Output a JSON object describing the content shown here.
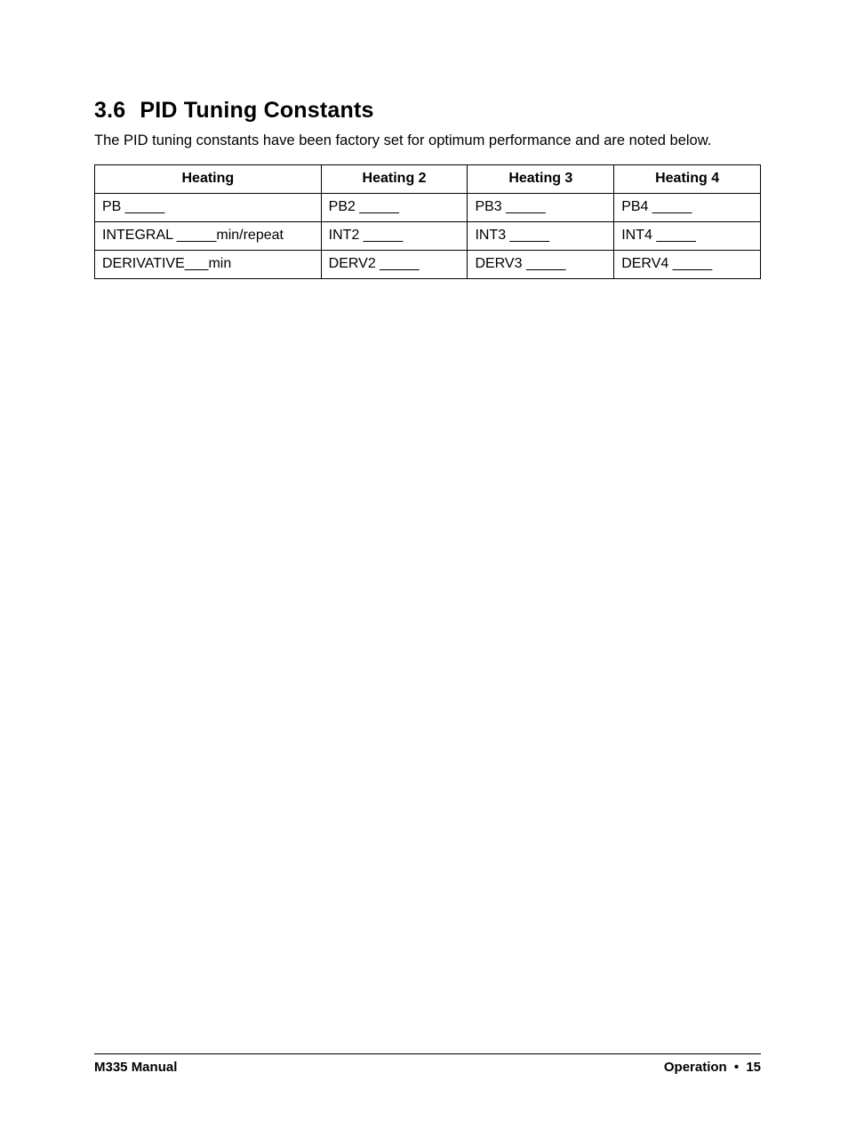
{
  "heading": {
    "number": "3.6",
    "title": "PID Tuning Constants"
  },
  "intro": "The PID tuning constants have been factory set for optimum performance and are noted below.",
  "table": {
    "headers": [
      "Heating",
      "Heating 2",
      "Heating 3",
      "Heating 4"
    ],
    "rows": [
      [
        "PB _____",
        "PB2 _____",
        "PB3 _____",
        "PB4 _____"
      ],
      [
        "INTEGRAL _____min/repeat",
        "INT2 _____",
        "INT3 _____",
        "INT4 _____"
      ],
      [
        "DERIVATIVE___min",
        "DERV2 _____",
        "DERV3 _____",
        "DERV4 _____"
      ]
    ]
  },
  "footer": {
    "left": "M335 Manual",
    "section": "Operation",
    "separator": "•",
    "page": "15"
  }
}
